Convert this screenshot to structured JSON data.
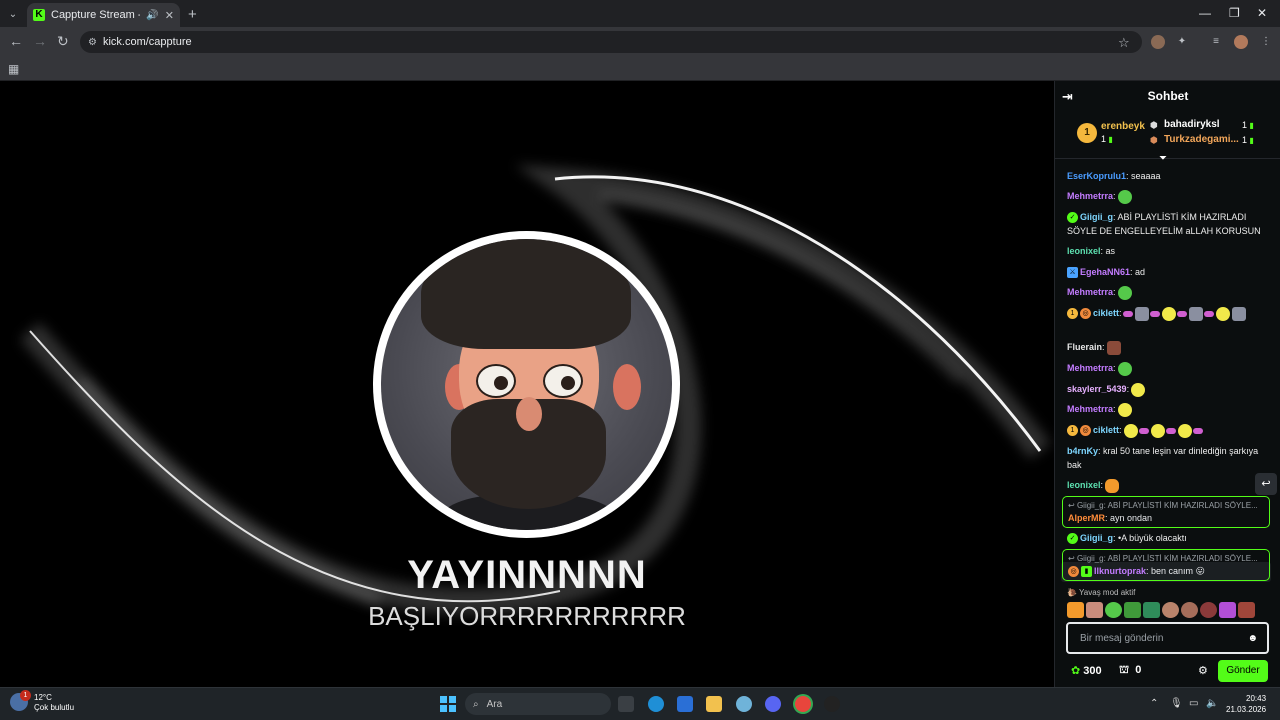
{
  "browser": {
    "tab_title": "Cappture Stream - Watch Li",
    "url": "kick.com/cappture",
    "new_tab_label": "+",
    "min_label": "—",
    "max_label": "❐",
    "close_label": "✕"
  },
  "stream": {
    "line1": "YAYINNNNN",
    "line2": "BAŞLIYORRRRRRRRRRR"
  },
  "chat": {
    "title": "Sohbet",
    "leaderboard": {
      "first": {
        "rank": "1",
        "name": "erenbeyk",
        "count": "1"
      },
      "second": {
        "name": "bahadiryksl",
        "count": "1"
      },
      "third": {
        "name": "Turkzadegami...",
        "count": "1"
      }
    },
    "messages": [
      {
        "user": "EserKoprulu1",
        "text": ": seaaaa",
        "color": "#4a9cff"
      },
      {
        "user": "Mehmetrra",
        "text": ":",
        "color": "#c37cff"
      },
      {
        "user": "Giigii_g",
        "text": ": ABİ PLAYLİSTİ KİM HAZIRLADI SÖYLE DE ENGELLEYELİM aLLAH KORUSUN",
        "color": "#7ed6ff"
      },
      {
        "user": "leonixel",
        "text": ": as",
        "color": "#5de0b0"
      },
      {
        "user": "EgehaNN61",
        "text": ": ad",
        "color": "#c37cff"
      },
      {
        "user": "Mehmetrra",
        "text": ":",
        "color": "#c37cff"
      },
      {
        "user": "ciklett",
        "text": ":",
        "color": "#7ed6ff"
      },
      {
        "user": "Fluerain",
        "text": ":",
        "color": "#e6e6e6"
      },
      {
        "user": "Mehmetrra",
        "text": ":",
        "color": "#c37cff"
      },
      {
        "user": "skaylerr_5439",
        "text": ":",
        "color": "#e6b0ff"
      },
      {
        "user": "Mehmetrra",
        "text": ":",
        "color": "#c37cff"
      },
      {
        "user": "ciklett",
        "text": ":",
        "color": "#7ed6ff"
      },
      {
        "user": "b4rnKy",
        "text": ": kral 50 tane leşin var dinlediğin şarkıya bak",
        "color": "#7ed6ff"
      },
      {
        "user": "leonixel",
        "text": ":",
        "color": "#5de0b0"
      }
    ],
    "replies": [
      {
        "ref": "Giigii_g: ABİ PLAYLİSTİ KİM HAZIRLADI SÖYLE...",
        "user": "AlperMR",
        "text": ": ayn ondan",
        "color": "#ff8c3a"
      },
      {
        "ref": "Giigii_g: ABİ PLAYLİSTİ KİM HAZIRLADI SÖYLE...",
        "user": "Ilknurtoprak",
        "text": ": ben canım 😛",
        "color": "#c37cff"
      }
    ],
    "between_reply": {
      "user": "Giigii_g",
      "text": ": •A büyük olacaktı",
      "color": "#7ed6ff"
    },
    "slow_mode": "Yavaş mod aktif",
    "input_placeholder": "Bir mesaj gönderin",
    "points": "300",
    "store_count": "0",
    "send_label": "Gönder"
  },
  "taskbar": {
    "temp": "12°C",
    "weather": "Çok bulutlu",
    "weather_badge": "1",
    "search": "Ara",
    "time": "20:43",
    "date": "21.03.2026"
  }
}
